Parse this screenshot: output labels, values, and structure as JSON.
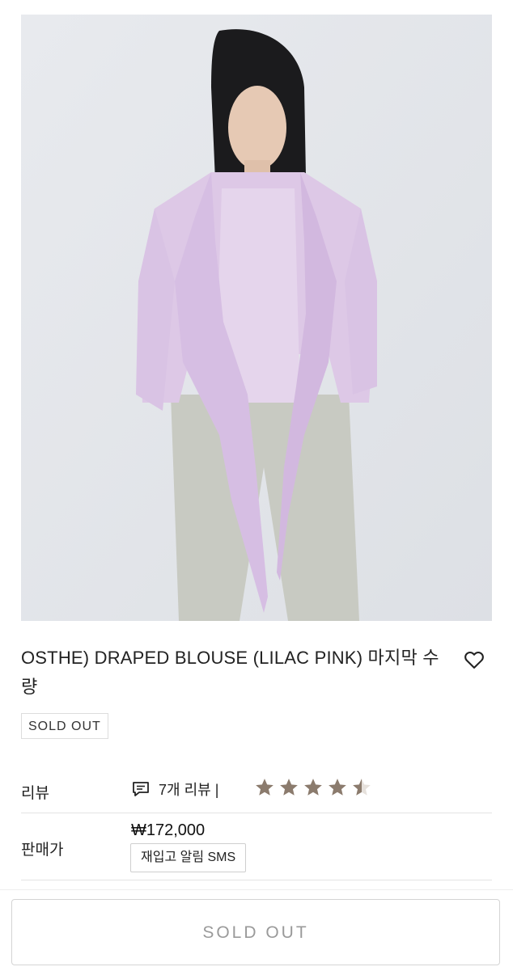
{
  "product": {
    "title": "OSTHE) DRAPED BLOUSE (LILAC PINK) 마지막 수량",
    "status_badge": "SOLD OUT",
    "image_alt": "Model wearing lilac pink draped blouse",
    "wishlist_icon": "heart-outline-icon"
  },
  "review": {
    "label": "리뷰",
    "count_text": "7개 리뷰 |",
    "icon": "review-chat-icon",
    "rating": 4.5,
    "max_rating": 5,
    "star_color": "#8b7b6d"
  },
  "price": {
    "label": "판매가",
    "value": "₩172,000",
    "restock_button": "재입고 알림 SMS"
  },
  "bottom": {
    "button_label": "SOLD OUT"
  },
  "colors": {
    "blouse": "#ddc8e6",
    "background": "#e4e6ea",
    "muted_text": "#9a9a9a"
  }
}
